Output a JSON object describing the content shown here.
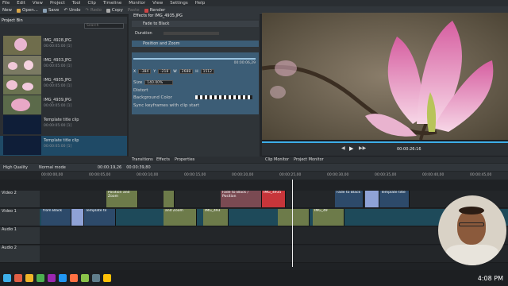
{
  "menu": [
    "File",
    "Edit",
    "View",
    "Project",
    "Tool",
    "Clip",
    "Timeline",
    "Monitor",
    "View",
    "Settings",
    "Help"
  ],
  "toolbar": {
    "new": "New",
    "open": "Open...",
    "save": "Save",
    "undo": "Undo",
    "redo": "Redo",
    "copy": "Copy",
    "paste": "Paste",
    "render": "Render"
  },
  "bin": {
    "header": "Project Bin",
    "search_placeholder": "Search",
    "items": [
      {
        "name": "IMG_4928.JPG",
        "sub": "00:00:05:00 [1]"
      },
      {
        "name": "IMG_4933.JPG",
        "sub": "00:00:05:00 [1]"
      },
      {
        "name": "IMG_4935.JPG",
        "sub": "00:00:05:00 [1]"
      },
      {
        "name": "IMG_4939.JPG",
        "sub": "00:00:05:00 [1]"
      },
      {
        "name": "Template title clip",
        "sub": "00:00:05:00 [1]"
      },
      {
        "name": "Template title clip",
        "sub": "00:00:05:00 [1]"
      }
    ]
  },
  "effects": {
    "title": "Effects for IMG_4935.JPG",
    "fade": "Fade to Black",
    "duration_label": "Duration",
    "pz_title": "Position and Zoom",
    "tc": "00:00:06,29",
    "x_label": "X",
    "x_val": "-384",
    "y_label": "Y",
    "y_val": "-218",
    "w_label": "W",
    "w_val": "2688",
    "h_label": "H",
    "h_val": "1512",
    "size_label": "Size",
    "size_val": "140.00%",
    "distort": "Distort",
    "bg_label": "Background Color",
    "sync": "Sync keyframes with clip start"
  },
  "monitor": {
    "timecode": "00:00:26:16",
    "clip_monitor": "Clip Monitor",
    "project_monitor": "Project Monitor"
  },
  "tabs": {
    "transitions": "Transitions",
    "effects": "Effects",
    "properties": "Properties"
  },
  "timeline": {
    "quality": "High Quality",
    "mode": "Normal mode",
    "pos": "00:00:19,26",
    "dur": "00:00:39,80",
    "ruler": [
      "00:00:00,00",
      "00:00:05,00",
      "00:00:10,00",
      "00:00:15,00",
      "00:00:20,00",
      "00:00:25,00",
      "00:00:30,00",
      "00:00:35,00",
      "00:00:40,00",
      "00:00:45,00"
    ],
    "tracks": [
      "Video 2",
      "Video 1",
      "Audio 1",
      "Audio 2"
    ],
    "v2_clips": [
      "Position and Zoom",
      "Fade to Black / Position",
      "IMG_4935",
      "Fade to Black",
      "Template title"
    ],
    "v1_clips": [
      "from Black",
      "Template til",
      "and Zoom",
      "IMG_493",
      "IMG_49"
    ]
  },
  "taskbar": {
    "clock": "4:08 PM"
  }
}
